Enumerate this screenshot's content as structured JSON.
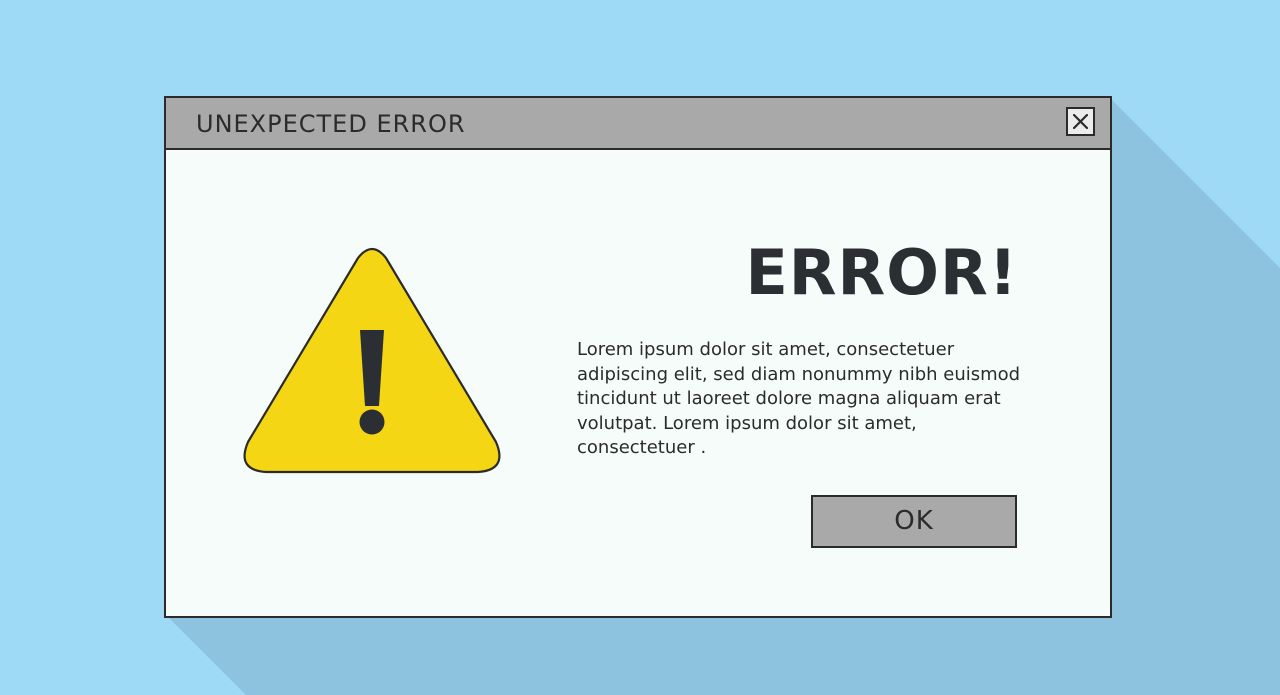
{
  "dialog": {
    "title": "UNEXPECTED ERROR",
    "heading": "ERROR!",
    "message": "Lorem ipsum dolor sit amet, consectetuer adipiscing elit, sed diam nonummy nibh euismod tincidunt ut laoreet dolore magna aliquam erat volutpat. Lorem ipsum dolor sit amet, consectetuer .",
    "ok_label": "OK",
    "close_icon": "close-icon",
    "warning_icon": "warning-triangle-icon"
  },
  "colors": {
    "background": "#9ed9f5",
    "shadow": "#8ec3e0",
    "titlebar": "#a9a9a9",
    "window_body": "#f6fcfa",
    "warning_yellow": "#f5d614",
    "ink": "#2b2b2b"
  }
}
